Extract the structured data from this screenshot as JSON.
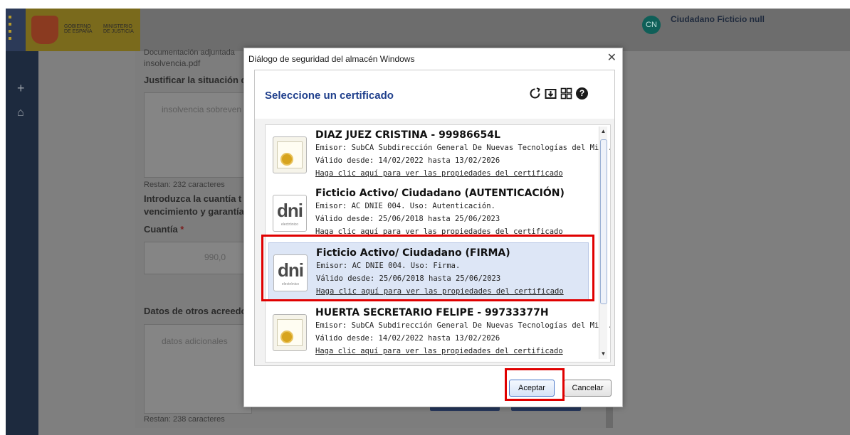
{
  "header": {
    "gov_text_1": "GOBIERNO\nDE ESPAÑA",
    "gov_text_1a": "GOBIERNO",
    "gov_text_1b": "DE ESPAÑA",
    "gov_text_2a": "MINISTERIO",
    "gov_text_2b": "DE JUSTICIA",
    "user_initials": "CN",
    "user_name": "Ciudadano Ficticio null"
  },
  "nav": {
    "add_icon": "+",
    "home_icon": "⌂"
  },
  "form": {
    "doc_label": "Documentación adjuntada",
    "doc_file": "insolvencia.pdf",
    "justify_label": "Justificar la situación d",
    "justify_value": "insolvencia sobreven",
    "remaining_1": "Restan: 232 caracteres",
    "amount_label_1": "Introduzca la cuantía t",
    "amount_label_2": "vencimiento y garantía",
    "cuantia_label": "Cuantía",
    "cuantia_required": "*",
    "cuantia_value": "990,0",
    "other_creditors_label": "Datos de otros acreedo",
    "additional_placeholder": "datos adicionales",
    "remaining_2": "Restan: 238 caracteres"
  },
  "dialog": {
    "title": "Diálogo de seguridad del almacén Windows",
    "close": "✕",
    "heading": "Seleccione un certificado",
    "icons": [
      "refresh-icon",
      "import-icon",
      "details-icon",
      "help-icon"
    ],
    "help_glyph": "?",
    "certificates": [
      {
        "name": "DIAZ JUEZ CRISTINA - 99986654L",
        "issuer": "Emisor: SubCA Subdirección General De Nuevas Tecnologías del Mi...",
        "validity": "Válido desde: 14/02/2022 hasta 13/02/2026",
        "link": "Haga clic aquí para ver las propiedades del certificado",
        "icon": "certificate-icon"
      },
      {
        "name": "Ficticio Activo/ Ciudadano (AUTENTICACIÓN)",
        "issuer": "Emisor: AC DNIE 004. Uso: Autenticación.",
        "validity": "Válido desde: 25/06/2018 hasta 25/06/2023",
        "link": "Haga clic aquí para ver las propiedades del certificado",
        "icon": "dni-icon"
      },
      {
        "name": "Ficticio Activo/ Ciudadano (FIRMA)",
        "issuer": "Emisor: AC DNIE 004. Uso: Firma.",
        "validity": "Válido desde: 25/06/2018 hasta 25/06/2023",
        "link": "Haga clic aquí para ver las propiedades del certificado",
        "icon": "dni-icon",
        "selected": true
      },
      {
        "name": "HUERTA SECRETARIO FELIPE - 99733377H",
        "issuer": "Emisor: SubCA Subdirección General De Nuevas Tecnologías del Mi...",
        "validity": "Válido desde: 14/02/2022 hasta 13/02/2026",
        "link": "Haga clic aquí para ver las propiedades del certificado",
        "icon": "certificate-icon"
      }
    ],
    "dni_logo": "dni",
    "dni_logo_sub": "electrónico",
    "accept_label": "Aceptar",
    "cancel_label": "Cancelar"
  },
  "colors": {
    "highlight": "#e00000",
    "heading_blue": "#1f3f8c",
    "nav_bg": "#1d2a3e",
    "selected_bg": "#dde6f6"
  }
}
